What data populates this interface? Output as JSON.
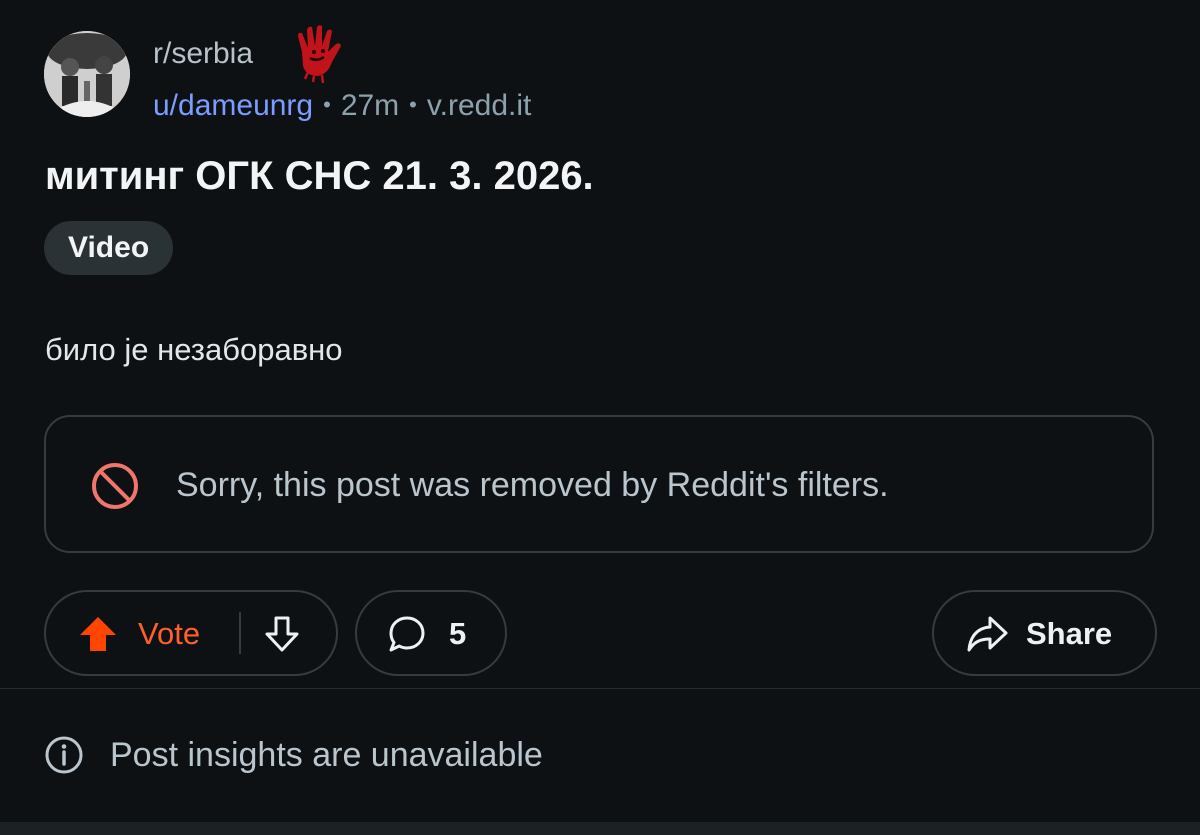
{
  "post": {
    "subreddit": "r/serbia",
    "author": "u/dameunrg",
    "age": "27m",
    "domain": "v.redd.it",
    "separator": "•",
    "title": "митинг ОГК СНС 21. 3. 2026.",
    "flair": "Video",
    "body": "било је незаборавно",
    "removed_notice": "Sorry, this post was removed by Reddit's filters."
  },
  "actions": {
    "vote_label": "Vote",
    "comment_count": "5",
    "share_label": "Share"
  },
  "insights": {
    "text": "Post insights are unavailable"
  },
  "icons": {
    "avatar": "subreddit-avatar",
    "flair": "red-handprint-icon",
    "removed": "prohibited-icon",
    "upvote": "upvote-arrow-icon",
    "downvote": "downvote-arrow-icon",
    "comment": "comment-bubble-icon",
    "share": "share-arrow-icon",
    "info": "info-icon"
  },
  "colors": {
    "background": "#0e1113",
    "accent_upvote": "#ff4500",
    "username": "#7c9cff",
    "removed_icon": "#f0756a"
  }
}
